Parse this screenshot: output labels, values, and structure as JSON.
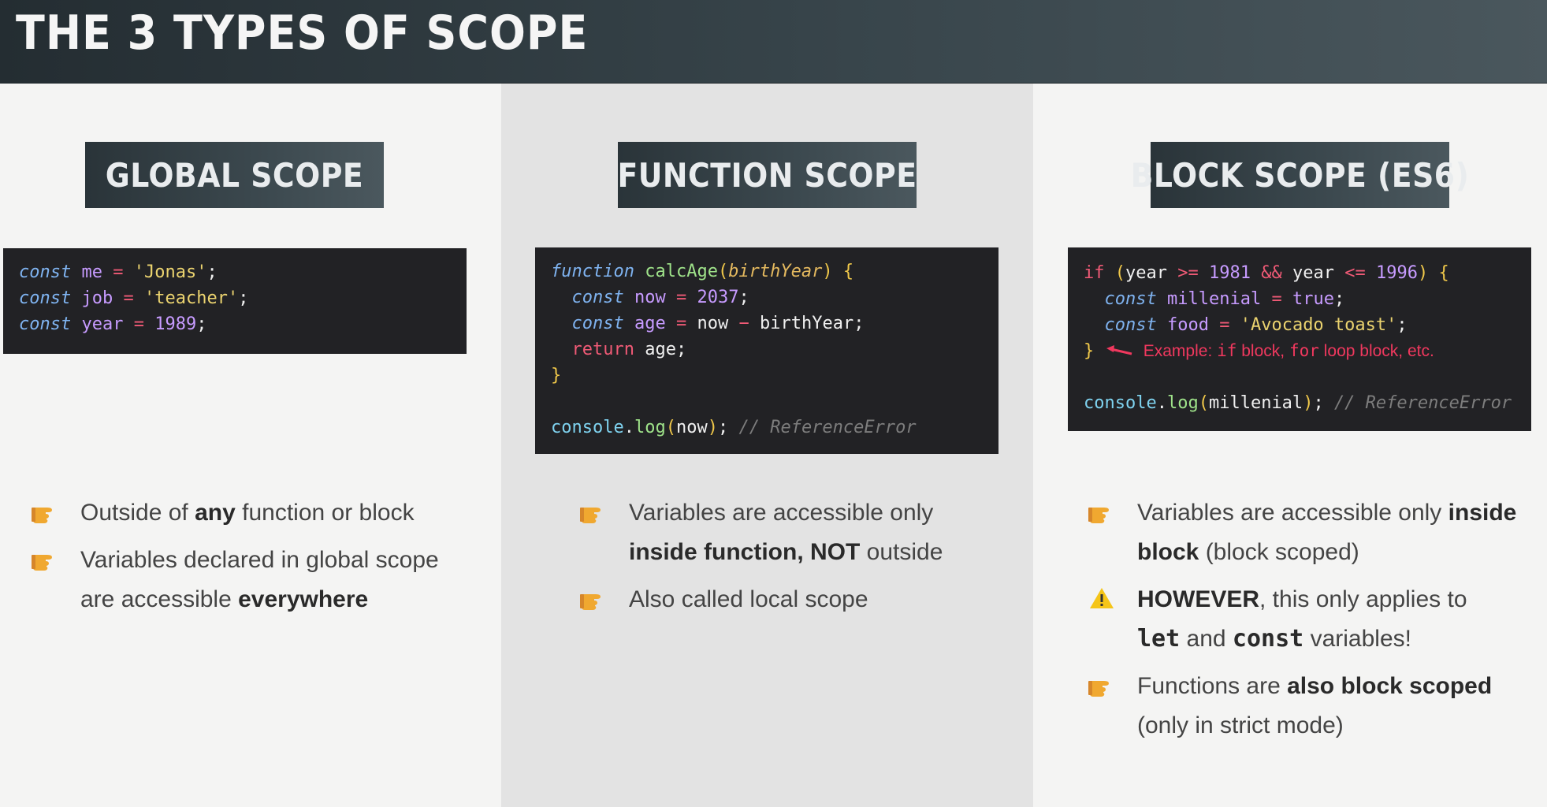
{
  "header": {
    "title": "THE 3 TYPES OF SCOPE"
  },
  "columns": [
    {
      "label": "GLOBAL SCOPE",
      "bullets": [
        {
          "pre": "Outside of ",
          "bold": "any",
          "post": " function or block"
        },
        {
          "pre": "Variables declared in global scope are accessible ",
          "bold": "everywhere",
          "post": ""
        }
      ]
    },
    {
      "label": "FUNCTION SCOPE",
      "bullets": [
        {
          "pre": "Variables are accessible only ",
          "bold": "inside function, NOT",
          "post": " outside"
        },
        {
          "pre": "Also called local scope",
          "bold": "",
          "post": ""
        }
      ]
    },
    {
      "label": "BLOCK SCOPE (ES6)",
      "bullets": [
        {
          "pre": "Variables are accessible only ",
          "bold": "inside block",
          "post": " (block scoped)"
        },
        {
          "bold": "HOWEVER",
          "post": ", this only applies to",
          "mono1": "let",
          "mid": " and ",
          "mono2": "const",
          "tail": " variables!"
        },
        {
          "pre": "Functions are ",
          "bold": "also block scoped",
          "post": " (only in strict mode)"
        }
      ]
    }
  ],
  "code": {
    "global": {
      "l1_kw": "const",
      "l1_var": "me",
      "l1_val": "'Jonas'",
      "l2_kw": "const",
      "l2_var": "job",
      "l2_val": "'teacher'",
      "l3_kw": "const",
      "l3_var": "year",
      "l3_val": "1989"
    },
    "function": {
      "kw": "function",
      "name": "calcAge",
      "param": "birthYear",
      "l2_kw": "const",
      "l2_var": "now",
      "l2_val": "2037",
      "l3_kw": "const",
      "l3_var": "age",
      "l3_a": "now",
      "l3_b": "birthYear",
      "ret": "return",
      "ret_val": "age",
      "log_obj": "console",
      "log_fn": "log",
      "log_arg": "now",
      "comment": "// ReferenceError"
    },
    "block": {
      "if": "if",
      "a": "year",
      "op1": ">=",
      "n1": "1981",
      "and": "&&",
      "b": "year",
      "op2": "<=",
      "n2": "1996",
      "l2_kw": "const",
      "l2_var": "millenial",
      "l2_val": "true",
      "l3_kw": "const",
      "l3_var": "food",
      "l3_val": "'Avocado toast'",
      "note_pre": "Example: ",
      "note_if": "if",
      "note_mid": " block, ",
      "note_for": "for",
      "note_post": " loop block, etc.",
      "log_obj": "console",
      "log_fn": "log",
      "log_arg": "millenial",
      "comment": "// ReferenceError"
    }
  },
  "colors": {
    "accent_orange": "#f0a830",
    "warning_yellow": "#f5c518",
    "note_red": "#f0385e"
  },
  "icons": {
    "bullet": "pointing-hand-icon",
    "warning": "warning-icon",
    "arrow": "red-arrow-icon"
  }
}
